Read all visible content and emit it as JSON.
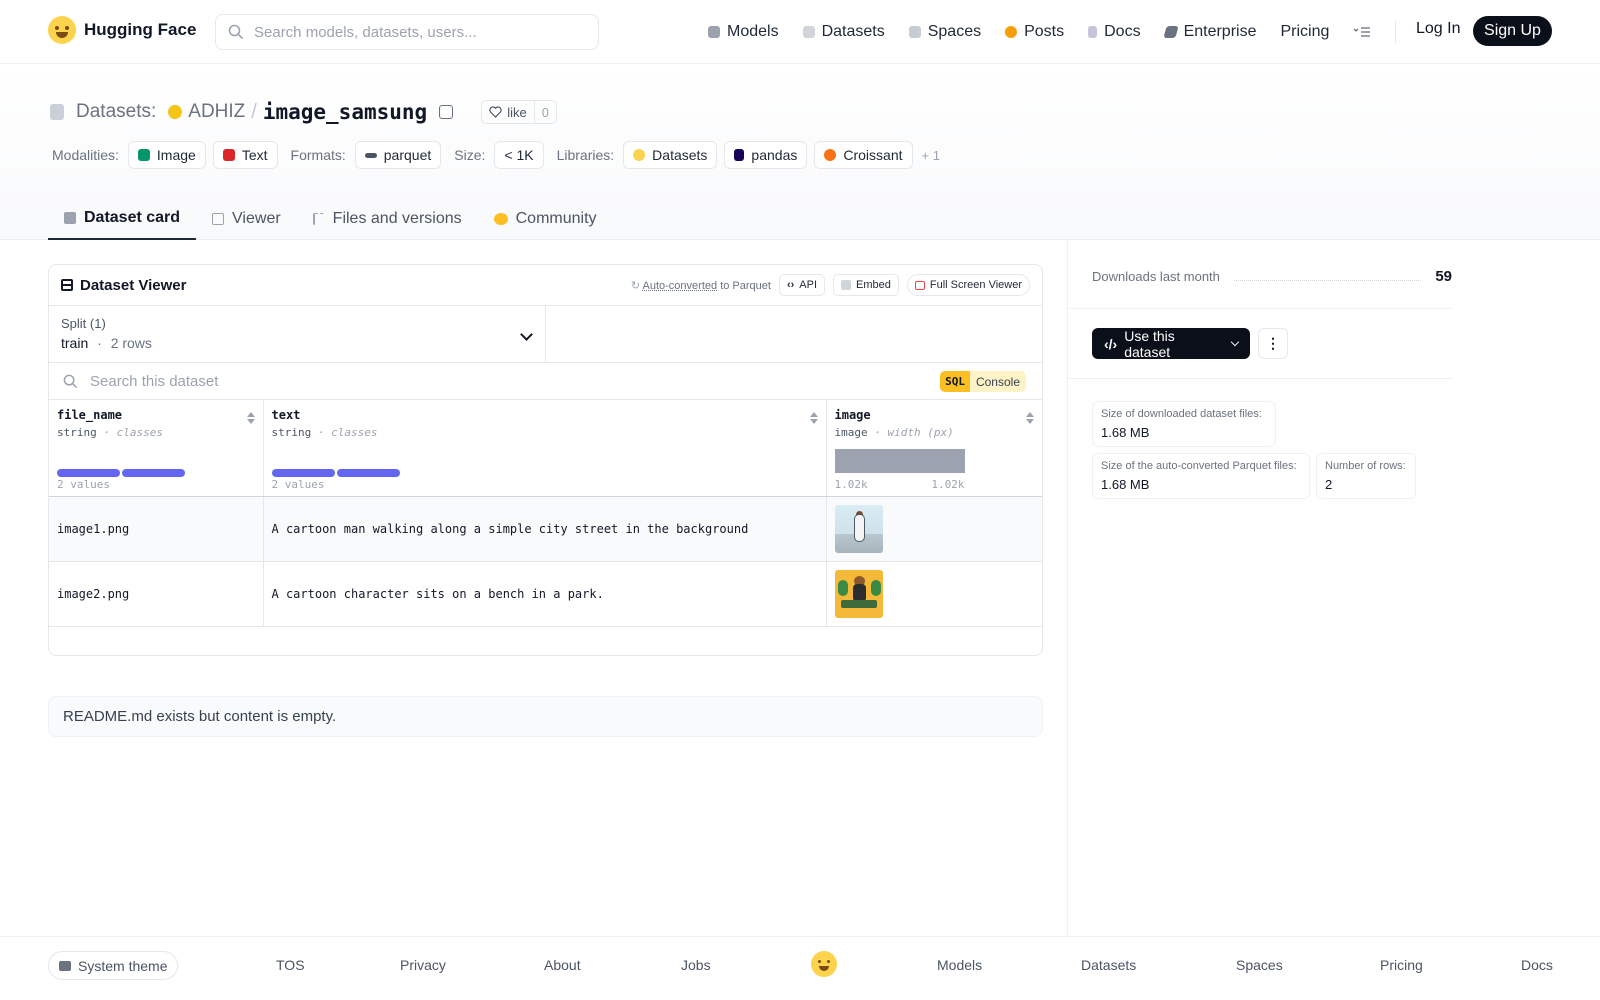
{
  "nav": {
    "logo_text": "Hugging Face",
    "search_placeholder": "Search models, datasets, users...",
    "links": [
      {
        "label": "Models",
        "icon": "cube-icon",
        "color": "#9ca3af"
      },
      {
        "label": "Datasets",
        "icon": "database-icon",
        "color": "#d1d5db"
      },
      {
        "label": "Spaces",
        "icon": "grid-icon",
        "color": "#c7ccd4"
      },
      {
        "label": "Posts",
        "icon": "posts-icon",
        "color": "#f59e0b"
      },
      {
        "label": "Docs",
        "icon": "docs-icon",
        "color": "#c7c3d9"
      },
      {
        "label": "Enterprise",
        "icon": "enterprise-icon",
        "color": "#6b7280"
      },
      {
        "label": "Pricing"
      }
    ],
    "login": "Log In",
    "signup": "Sign Up"
  },
  "header": {
    "section_label": "Datasets:",
    "org": "ADHIZ",
    "slash": "/",
    "dataset_name": "image_samsung",
    "like_label": "like",
    "like_count": "0",
    "modalities_label": "Modalities:",
    "modalities": [
      {
        "label": "Image",
        "color": "#059669"
      },
      {
        "label": "Text",
        "color": "#dc2626"
      }
    ],
    "formats_label": "Formats:",
    "format": "parquet",
    "size_label": "Size:",
    "size": "< 1K",
    "libraries_label": "Libraries:",
    "libraries": [
      "Datasets",
      "pandas",
      "Croissant"
    ],
    "libraries_more": "+ 1"
  },
  "tabs": [
    {
      "label": "Dataset card",
      "active": true
    },
    {
      "label": "Viewer"
    },
    {
      "label": "Files and versions"
    },
    {
      "label": "Community"
    }
  ],
  "viewer": {
    "title": "Dataset Viewer",
    "auto_converted": "Auto-converted",
    "to_parquet": "to Parquet",
    "api": "API",
    "embed": "Embed",
    "fullscreen": "Full Screen Viewer",
    "split_label": "Split (1)",
    "split_name": "train",
    "split_sep": "·",
    "split_rows": "2 rows",
    "search_placeholder": "Search this dataset",
    "sql_label": "SQL",
    "console_label": "Console",
    "columns": [
      {
        "name": "file_name",
        "type": "string",
        "hint": "· classes",
        "summary": "2 values"
      },
      {
        "name": "text",
        "type": "string",
        "hint": "· classes",
        "summary": "2 values"
      },
      {
        "name": "image",
        "type": "image",
        "hint": "· width (px)",
        "min": "1.02k",
        "max": "1.02k"
      }
    ],
    "rows": [
      {
        "file_name": "image1.png",
        "text": "A cartoon man walking along a simple city street in the background"
      },
      {
        "file_name": "image2.png",
        "text": "A cartoon character sits on a bench in a park."
      }
    ]
  },
  "readme_notice": "README.md exists but content is empty.",
  "sidebar": {
    "downloads_label": "Downloads last month",
    "downloads_value": "59",
    "use_button": "Use this dataset",
    "more_button": "⋮",
    "stats": [
      {
        "label": "Size of downloaded dataset files:",
        "value": "1.68 MB"
      },
      {
        "label": "Size of the auto-converted Parquet files:",
        "value": "1.68 MB"
      },
      {
        "label": "Number of rows:",
        "value": "2"
      }
    ]
  },
  "footer": {
    "theme": "System theme",
    "links": [
      "TOS",
      "Privacy",
      "About",
      "Jobs",
      "Models",
      "Datasets",
      "Spaces",
      "Pricing",
      "Docs"
    ]
  }
}
